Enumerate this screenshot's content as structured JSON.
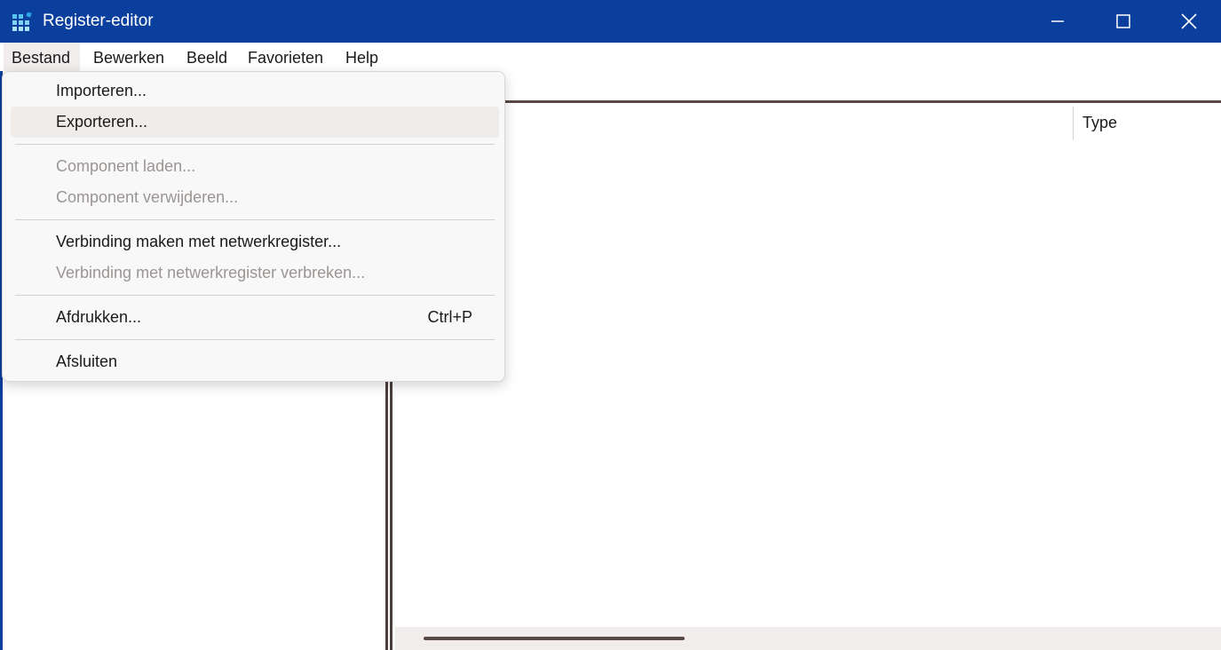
{
  "window": {
    "title": "Register-editor",
    "title_bar_color": "#0b3f9e",
    "icons": {
      "app": "registry-editor-icon",
      "minimize": "minimize-icon",
      "maximize": "maximize-icon",
      "close": "close-icon"
    }
  },
  "menubar": {
    "items": [
      {
        "label": "Bestand",
        "active": true
      },
      {
        "label": "Bewerken"
      },
      {
        "label": "Beeld"
      },
      {
        "label": "Favorieten"
      },
      {
        "label": "Help"
      }
    ]
  },
  "file_menu": {
    "items": [
      {
        "label": "Importeren...",
        "enabled": true
      },
      {
        "label": "Exporteren...",
        "enabled": true,
        "highlighted": true
      },
      {
        "label": "Component laden...",
        "enabled": false
      },
      {
        "label": "Component verwijderen...",
        "enabled": false
      },
      {
        "label": "Verbinding maken met netwerkregister...",
        "enabled": true
      },
      {
        "label": "Verbinding met netwerkregister verbreken...",
        "enabled": false
      },
      {
        "label": "Afdrukken...",
        "shortcut": "Ctrl+P",
        "enabled": true
      },
      {
        "label": "Afsluiten",
        "enabled": true
      }
    ]
  },
  "list_view": {
    "columns": [
      {
        "label": "Type"
      }
    ]
  }
}
